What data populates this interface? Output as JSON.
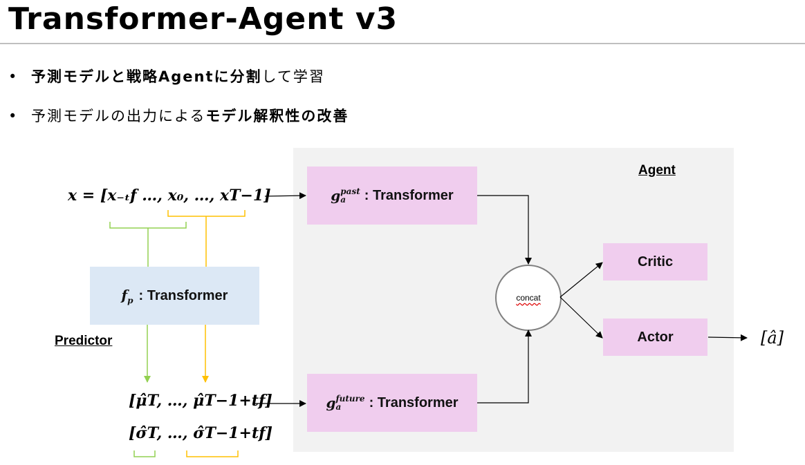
{
  "title": "Transformer-Agent v3",
  "bullets": [
    {
      "bold_part": "予測モデルと戦略Agentに分割",
      "plain_part": "して学習"
    },
    {
      "plain_part": "予測モデルの出力による",
      "bold_part": "モデル解釈性の改善"
    }
  ],
  "bullet_symbol": "•",
  "diagram": {
    "agent_label": "Agent",
    "predictor_label": "Predictor",
    "fp_box": {
      "fn": "f",
      "sub": "p",
      "label": ": Transformer"
    },
    "past_box": {
      "fn": "g",
      "sup": "past",
      "sub": "a",
      "label": ": Transformer"
    },
    "future_box": {
      "fn": "g",
      "sup": "future",
      "sub": "a",
      "label": ": Transformer"
    },
    "critic": "Critic",
    "actor": "Actor",
    "concat": "concat",
    "input_eq": "x = [x₋ₜf …, x₀, …, xT−1]",
    "mu_eq": "[μ̂T, …, μ̂T−1+tf]",
    "sigma_eq": "[σ̂T, …, σ̂T−1+tf]",
    "output": "[â]"
  },
  "colors": {
    "pink": "#f0cdee",
    "blue": "#dce8f5",
    "panel": "#f2f2f2",
    "green_bracket": "#92d050",
    "orange_bracket": "#ffc000"
  }
}
